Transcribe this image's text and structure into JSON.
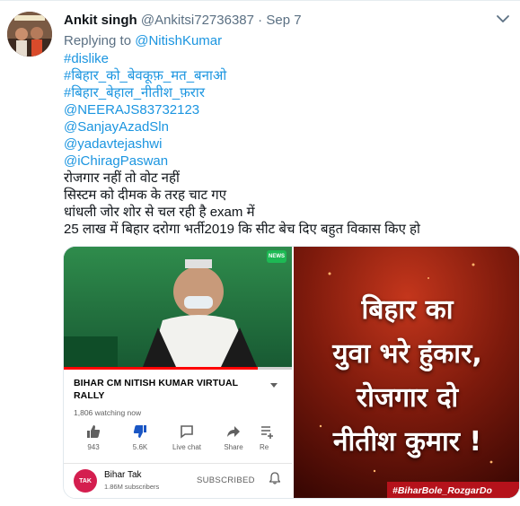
{
  "tweet": {
    "author_name": "Ankit singh",
    "author_handle": "@Ankitsi72736387",
    "separator": "·",
    "date": "Sep 7",
    "replying_label": "Replying to",
    "replying_handle": "@NitishKumar",
    "lines": [
      {
        "text": "#dislike",
        "link": true
      },
      {
        "text": "#बिहार_को_बेवकूफ़_मत_बनाओ",
        "link": true
      },
      {
        "text": "#बिहार_बेहाल_नीतीश_फ़रार",
        "link": true
      },
      {
        "text": "@NEERAJS83732123",
        "link": true
      },
      {
        "text": "@SanjayAzadSln",
        "link": true
      },
      {
        "text": "@yadavtejashwi",
        "link": true
      },
      {
        "text": "@iChiragPaswan",
        "link": true
      },
      {
        "text": "रोजगार नहीं तो वोट नहीं",
        "link": false
      },
      {
        "text": "सिस्टम को दीमक के तरह चाट गए",
        "link": false
      },
      {
        "text": "धांधली जोर शोर से चल रही है exam में",
        "link": false
      },
      {
        "text": "25 लाख में बिहार दरोगा भर्ती2019 कि सीट बेच दिए बहुत विकास किए हो",
        "link": false
      }
    ]
  },
  "video_card": {
    "logo_text": "NEWS",
    "progress_fraction": 0.85,
    "title": "BIHAR CM NITISH KUMAR VIRTUAL RALLY",
    "watching": "1,806 watching now",
    "actions": [
      {
        "icon": "thumbs-up-icon",
        "label": "943"
      },
      {
        "icon": "thumbs-down-icon",
        "label": "5.6K"
      },
      {
        "icon": "live-chat-icon",
        "label": "Live chat"
      },
      {
        "icon": "share-icon",
        "label": "Share"
      },
      {
        "icon": "save-icon",
        "label": "Re"
      }
    ],
    "channel_logo_text": "TAK",
    "channel_name": "Bihar Tak",
    "subscribers": "1.86M subscribers",
    "subscribed_label": "SUBSCRIBED"
  },
  "banner": {
    "lines": [
      "बिहार का",
      "युवा भरे हुंकार,",
      "रोजगार दो",
      "नीतीश कुमार !"
    ],
    "hashtag": "#BiharBole_RozgarDo"
  },
  "colors": {
    "link": "#1b95e0",
    "secondary_text": "#5b7083",
    "banner_bg": "#6e1208",
    "hashtag_bar": "#b5121b"
  }
}
